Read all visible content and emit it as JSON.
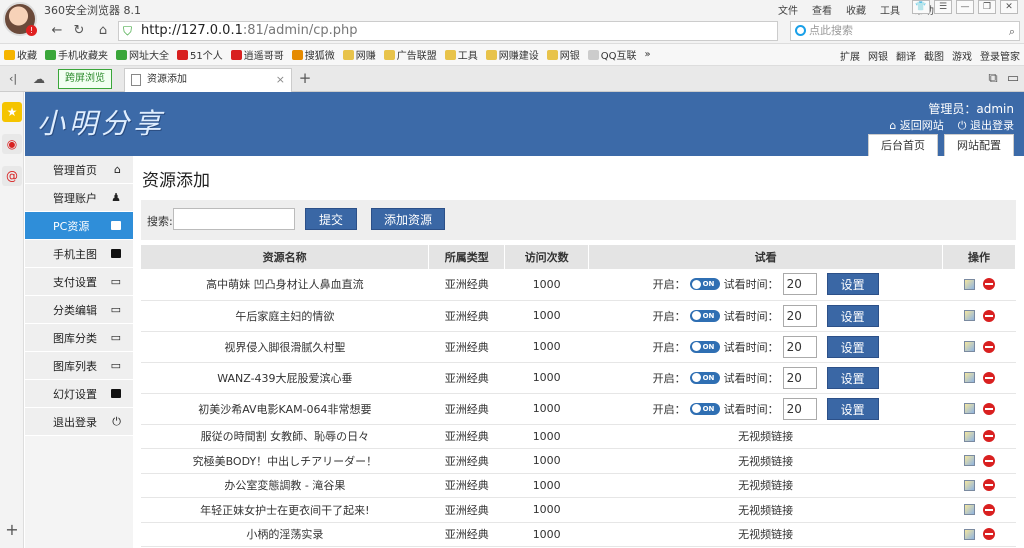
{
  "browser": {
    "app_title": "360安全浏览器 8.1",
    "menu": [
      "文件",
      "查看",
      "收藏",
      "工具",
      "帮助"
    ],
    "avatar_badge": "!",
    "url_host": "http://127.0.0.1",
    "url_rest": ":81/admin/cp.php",
    "search_placeholder": "点此搜索",
    "bookmarks": [
      {
        "label": "收藏",
        "color": "#f5b400"
      },
      {
        "label": "手机收藏夹",
        "color": "#3aa63a"
      },
      {
        "label": "网址大全",
        "color": "#3aa63a"
      },
      {
        "label": "51个人",
        "color": "#d82020"
      },
      {
        "label": "逍遥哥哥",
        "color": "#d82020"
      },
      {
        "label": "搜狐微",
        "color": "#e58a00"
      },
      {
        "label": "网赚",
        "color": "#e8c34a"
      },
      {
        "label": "广告联盟",
        "color": "#e8c34a"
      },
      {
        "label": "工具",
        "color": "#e8c34a"
      },
      {
        "label": "网赚建设",
        "color": "#e8c34a"
      },
      {
        "label": "网银",
        "color": "#e8c34a"
      },
      {
        "label": "QQ互联",
        "color": "#cccccc"
      }
    ],
    "bookmarks_more": "»",
    "bookmarks_right": [
      "扩展",
      "网银",
      "翻译",
      "截图",
      "游戏",
      "登录管家"
    ],
    "tabs": {
      "green_tab": "跨屏浏览",
      "active_tab": "资源添加",
      "close": "×",
      "add": "+"
    }
  },
  "header": {
    "logo": "小明分享",
    "admin_label": "管理员：admin",
    "back_link": "返回网站",
    "logout_link": "退出登录",
    "tab_home": "后台首页",
    "tab_config": "网站配置"
  },
  "sidebar": {
    "items": [
      {
        "label": "管理首页",
        "active": false
      },
      {
        "label": "管理账户",
        "active": false
      },
      {
        "label": "PC资源",
        "active": true
      },
      {
        "label": "手机主图",
        "active": false
      },
      {
        "label": "支付设置",
        "active": false
      },
      {
        "label": "分类编辑",
        "active": false
      },
      {
        "label": "图库分类",
        "active": false
      },
      {
        "label": "图库列表",
        "active": false
      },
      {
        "label": "幻灯设置",
        "active": false
      },
      {
        "label": "退出登录",
        "active": false
      }
    ]
  },
  "main": {
    "title": "资源添加",
    "search_label": "搜索:",
    "search_value": "",
    "submit_label": "提交",
    "add_label": "添加资源",
    "columns": [
      "资源名称",
      "所属类型",
      "访问次数",
      "试看",
      "操作"
    ],
    "open_label": "开启：",
    "toggle_label": "ON",
    "trial_time_label": "试看时间：",
    "set_label": "设置",
    "no_video_label": "无视频链接",
    "rows": [
      {
        "name": "高中萌妹 凹凸身材让人鼻血直流",
        "type": "亚洲经典",
        "visits": "1000",
        "trial": true,
        "time": "20"
      },
      {
        "name": "午后家庭主妇的情欲",
        "type": "亚洲经典",
        "visits": "1000",
        "trial": true,
        "time": "20"
      },
      {
        "name": "视界侵入脚很滑腻久村聖",
        "type": "亚洲经典",
        "visits": "1000",
        "trial": true,
        "time": "20"
      },
      {
        "name": "WANZ-439大屁股爱滨心垂",
        "type": "亚洲经典",
        "visits": "1000",
        "trial": true,
        "time": "20"
      },
      {
        "name": "初美沙希AV电影KAM-064非常想要",
        "type": "亚洲经典",
        "visits": "1000",
        "trial": true,
        "time": "20"
      },
      {
        "name": "服従の時間割 女教師、恥辱の日々",
        "type": "亚洲经典",
        "visits": "1000",
        "trial": false
      },
      {
        "name": "究極美BODY！中出しチアリーダー！",
        "type": "亚洲经典",
        "visits": "1000",
        "trial": false
      },
      {
        "name": "办公室変態調教 - 滝谷果",
        "type": "亚洲经典",
        "visits": "1000",
        "trial": false
      },
      {
        "name": "年轻正妹女护士在更衣间干了起来!",
        "type": "亚洲经典",
        "visits": "1000",
        "trial": false
      },
      {
        "name": "小柄的淫荡实录",
        "type": "亚洲经典",
        "visits": "1000",
        "trial": false
      }
    ]
  }
}
